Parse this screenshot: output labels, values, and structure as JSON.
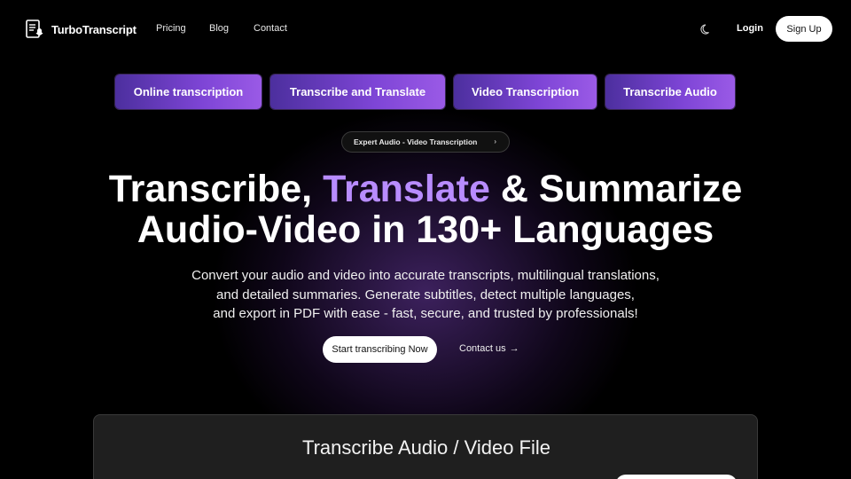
{
  "header": {
    "brand": "TurboTranscript",
    "nav": [
      {
        "label": "Pricing"
      },
      {
        "label": "Blog"
      },
      {
        "label": "Contact"
      }
    ],
    "theme_icon": "moon-icon",
    "login_label": "Login",
    "signup_label": "Sign Up"
  },
  "features": [
    {
      "label": "Online transcription"
    },
    {
      "label": "Transcribe and Translate"
    },
    {
      "label": "Video Transcription"
    },
    {
      "label": "Transcribe Audio"
    }
  ],
  "badge": {
    "label": "Expert Audio - Video Transcription",
    "icon": "chevron-right-icon"
  },
  "hero": {
    "line1_a": "Transcribe, ",
    "line1_accent": "Translate",
    "line1_b": " & Summarize",
    "line2": "Audio-Video in 130+ Languages",
    "sub1": "Convert your audio and video into accurate transcripts, multilingual translations,",
    "sub2": "and detailed summaries. Generate subtitles, detect multiple languages,",
    "sub3": "and export in PDF with ease - fast, secure, and trusted by professionals!",
    "cta_primary": "Start transcribing Now",
    "cta_secondary": "Contact us",
    "cta_secondary_icon": "arrow-right-icon"
  },
  "upload_card": {
    "title": "Transcribe Audio / Video File"
  },
  "colors": {
    "accent": "#b88cff",
    "pill_start": "#4c2f9e",
    "pill_end": "#9a5ae6",
    "background": "#000000"
  }
}
